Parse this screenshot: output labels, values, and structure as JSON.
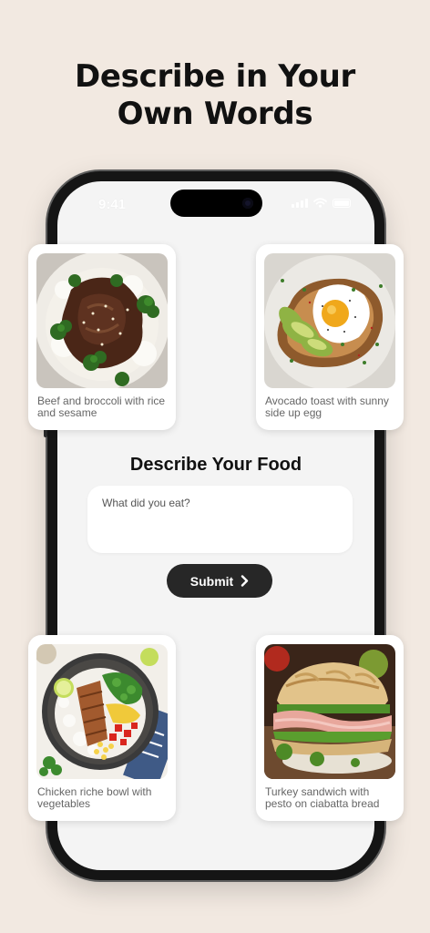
{
  "headline": {
    "line1": "Describe in Your",
    "line2": "Own Words"
  },
  "status_bar": {
    "time": "9:41"
  },
  "screen": {
    "title": "Describe Your Food",
    "input": {
      "placeholder": "What did you eat?",
      "value": ""
    },
    "submit_label": "Submit"
  },
  "cards": [
    {
      "caption": "Beef and broccoli with rice and sesame"
    },
    {
      "caption": "Avocado toast with sunny side up egg"
    },
    {
      "caption": "Chicken riche bowl with vegetables"
    },
    {
      "caption": "Turkey sandwich with pesto on ciabatta bread"
    }
  ],
  "colors": {
    "background": "#f2e9e1",
    "button": "#272727",
    "phone_frame": "#151515"
  }
}
